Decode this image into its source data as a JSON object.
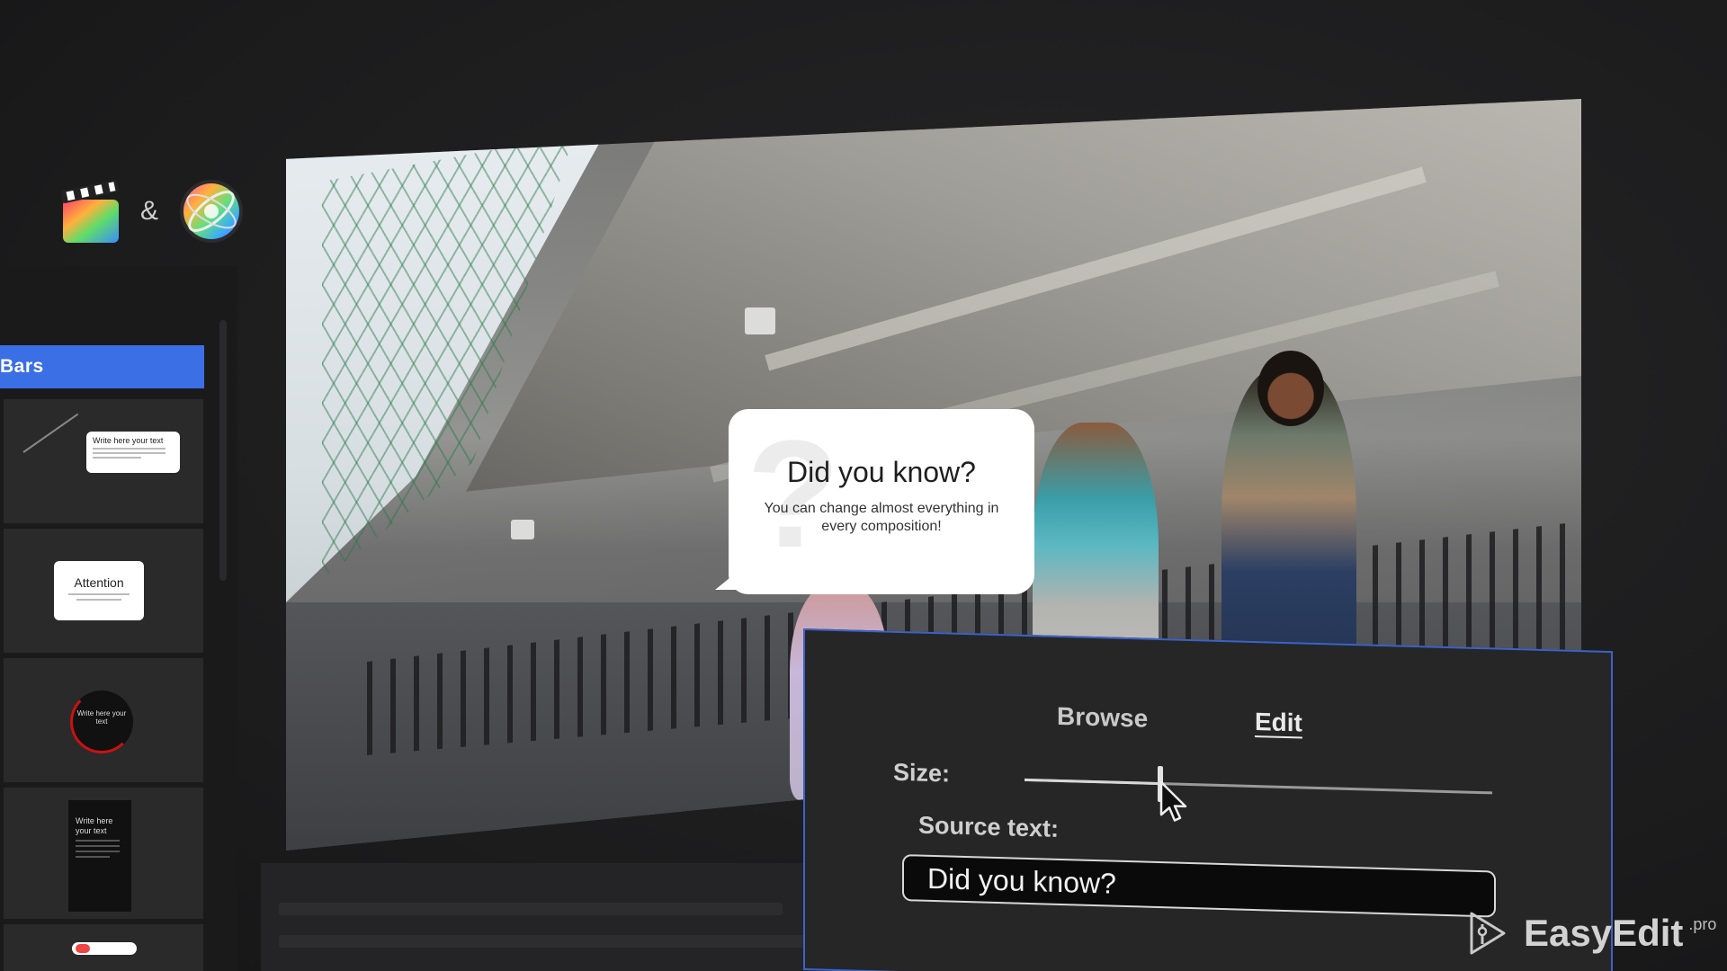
{
  "logos": {
    "ampersand": "&",
    "icons": [
      "final-cut-pro-icon",
      "motion-icon"
    ]
  },
  "sidebar": {
    "header": "Bars",
    "accent": "#3b6fe6",
    "thumbnails": [
      {
        "title": "Write here your text",
        "style": "callout-line"
      },
      {
        "title": "Attention",
        "style": "white-card"
      },
      {
        "title": "Write here your text",
        "style": "circle"
      },
      {
        "title": "Write here your text",
        "style": "dark-card"
      },
      {
        "title": "",
        "style": "pill"
      }
    ]
  },
  "preview": {
    "bubble": {
      "title": "Did you know?",
      "body": "You can change almost everything in every composition!"
    }
  },
  "panel": {
    "tabs": {
      "browse": "Browse",
      "edit": "Edit"
    },
    "active_tab": "Edit",
    "size_label": "Size:",
    "size_value": 0.29,
    "source_label": "Source text:",
    "source_value": "Did you know?",
    "border_color": "#3a63c9"
  },
  "watermark": {
    "name": "EasyEdit",
    "suffix": ".pro"
  }
}
